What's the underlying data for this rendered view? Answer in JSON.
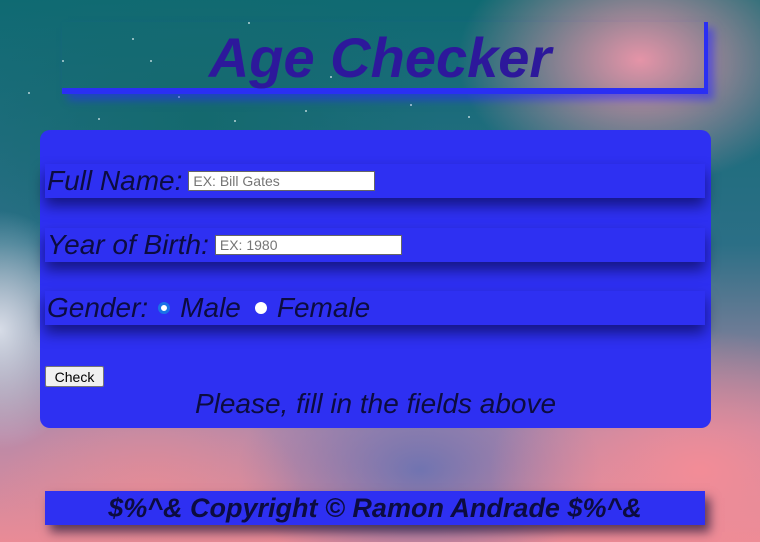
{
  "header": {
    "title": "Age Checker"
  },
  "form": {
    "full_name": {
      "label": "Full Name:",
      "placeholder": "EX: Bill Gates",
      "value": ""
    },
    "year_of_birth": {
      "label": "Year of Birth:",
      "placeholder": "EX: 1980",
      "value": ""
    },
    "gender": {
      "label": "Gender:",
      "options": [
        {
          "label": "Male",
          "selected": true
        },
        {
          "label": "Female",
          "selected": false
        }
      ]
    },
    "check_button": "Check",
    "status_text": "Please, fill in the fields above"
  },
  "footer": {
    "text": "$%^& Copyright © Ramon Andrade $%^&"
  },
  "colors": {
    "panel": "#2e30f2",
    "title": "#2d189b",
    "text": "#0c0c40"
  }
}
